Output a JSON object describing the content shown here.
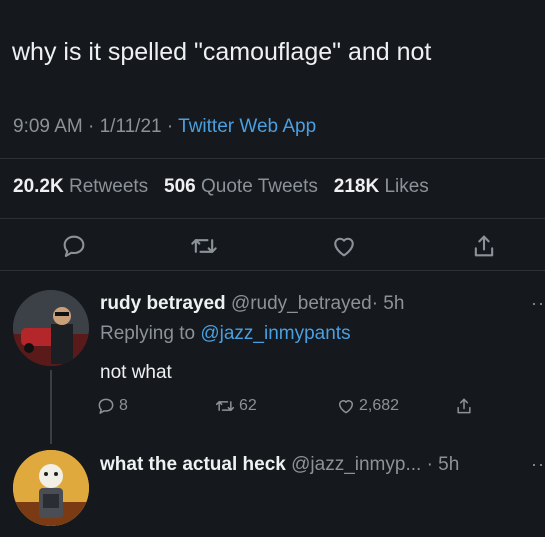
{
  "tweet": {
    "text": "why is it spelled \"camouflage\" and not",
    "time": "9:09 AM",
    "date": "1/11/21",
    "source": "Twitter Web App",
    "separator": " · "
  },
  "stats": {
    "retweets_count": "20.2K",
    "retweets_label": "Retweets",
    "quotes_count": "506",
    "quotes_label": "Quote Tweets",
    "likes_count": "218K",
    "likes_label": "Likes"
  },
  "actions": [
    "reply-icon",
    "retweet-icon",
    "like-icon",
    "share-icon"
  ],
  "reply1": {
    "name": "rudy betrayed",
    "handle": "@rudy_betrayed",
    "age": "· 5h",
    "replying_prefix": "Replying to",
    "replying_to": "@jazz_inmypants",
    "text": "not what",
    "reply_count": "8",
    "retweet_count": "62",
    "like_count": "2,682",
    "more": "··"
  },
  "reply2": {
    "name": "what the actual heck",
    "handle": "@jazz_inmyp...",
    "age": "· 5h",
    "more": "··"
  },
  "colors": {
    "background": "#15181c",
    "text": "#eef0f1",
    "secondary": "#8b9298",
    "link": "#4a9fe0",
    "divider": "#2c3136"
  }
}
